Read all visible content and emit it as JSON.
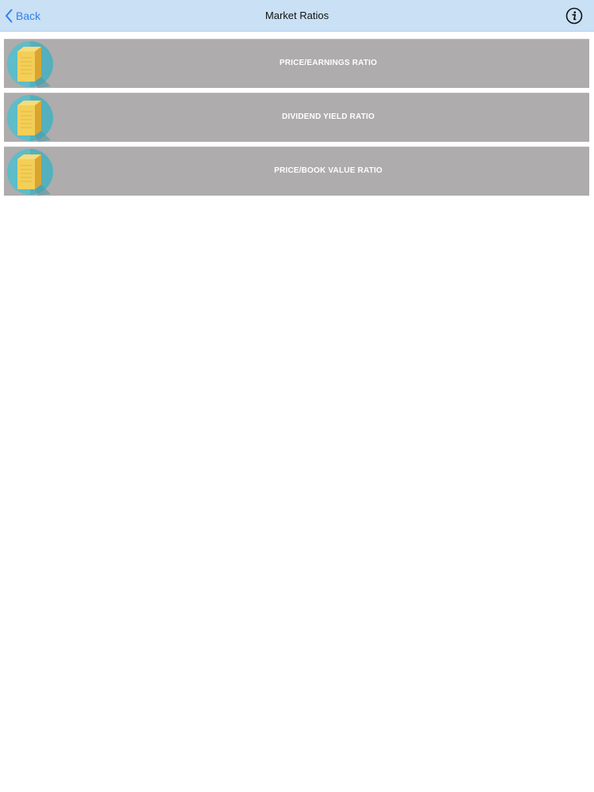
{
  "navbar": {
    "back_label": "Back",
    "title": "Market Ratios",
    "info_icon": "info-circle-icon"
  },
  "items": [
    {
      "label": "PRICE/EARNINGS RATIO",
      "icon": "book-icon"
    },
    {
      "label": "DIVIDEND YIELD RATIO",
      "icon": "book-icon"
    },
    {
      "label": "PRICE/BOOK VALUE RATIO",
      "icon": "book-icon"
    }
  ],
  "colors": {
    "navbar_bg": "#c9e0f5",
    "accent": "#2f7ff0",
    "row_bg": "#aeacad",
    "icon_circle": "#5fbcc9",
    "book_yellow": "#f3cf58"
  }
}
